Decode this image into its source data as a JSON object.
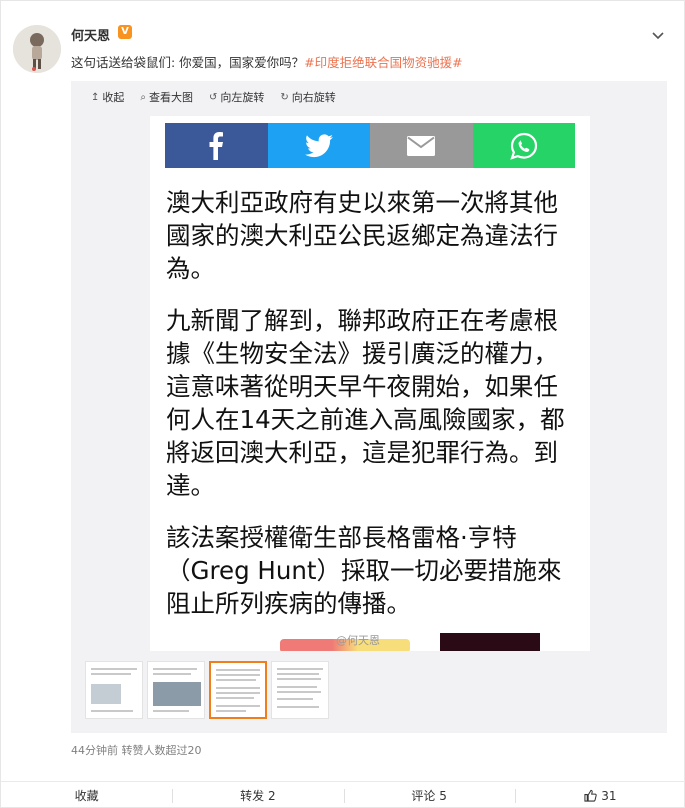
{
  "post": {
    "username": "何天恩",
    "verified_badge": "V",
    "text_prefix": "这句话送给袋鼠们: 你爱国，国家爱你吗？",
    "hashtag_1": "#印度",
    "hashtag_2": "拒绝联合国物资驰援#",
    "meta": "44分钟前 转赞人数超过20",
    "accent_color": "#eb7350"
  },
  "toolbar": {
    "collapse": "收起",
    "view_large": "查看大图",
    "rotate_left": "向左旋转",
    "rotate_right": "向右旋转"
  },
  "image": {
    "share_buttons": [
      "facebook-icon",
      "twitter-icon",
      "email-icon",
      "whatsapp-icon"
    ],
    "paragraph_1": "澳大利亞政府有史以來第一次將其他國家的澳大利亞公民返鄉定為違法行為。",
    "paragraph_2": "九新聞了解到，聯邦政府正在考慮根據《生物安全法》援引廣泛的權力，這意味著從明天早午夜開始，如果任何人在14天之前進入高風險國家，都將返回澳大利亞，這是犯罪行為。到達。",
    "paragraph_3": "該法案授權衛生部長格雷格·亨特（Greg Hunt）採取一切必要措施來阻止所列疾病的傳播。",
    "watermark": "@何天恩"
  },
  "actions": {
    "favorite": "收藏",
    "repost": "转发 2",
    "comment": "评论 5",
    "like": "31"
  }
}
